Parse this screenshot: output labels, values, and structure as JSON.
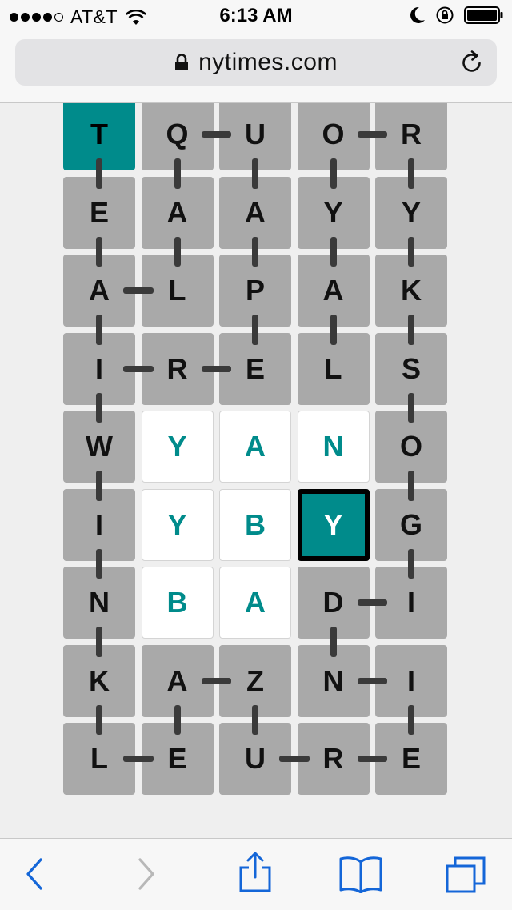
{
  "status_bar": {
    "carrier": "AT&T",
    "signal_bars_filled": 4,
    "signal_bars_total": 5,
    "time": "6:13 AM",
    "icons": [
      "wifi-icon",
      "moon-icon",
      "rotation-lock-icon",
      "battery-icon"
    ]
  },
  "browser": {
    "url": "nytimes.com",
    "icons": [
      "padlock-icon",
      "reload-icon"
    ]
  },
  "board": {
    "rows": [
      [
        "T",
        "Q",
        "U",
        "O",
        "R"
      ],
      [
        "E",
        "A",
        "A",
        "Y",
        "Y"
      ],
      [
        "A",
        "L",
        "P",
        "A",
        "K"
      ],
      [
        "I",
        "R",
        "E",
        "L",
        "S"
      ],
      [
        "W",
        "Y",
        "A",
        "N",
        "O"
      ],
      [
        "I",
        "Y",
        "B",
        "Y",
        "G"
      ],
      [
        "N",
        "B",
        "A",
        "D",
        "I"
      ],
      [
        "K",
        "A",
        "Z",
        "N",
        "I"
      ],
      [
        "L",
        "E",
        "U",
        "R",
        "E"
      ]
    ],
    "states": [
      [
        "teal",
        "grey",
        "grey",
        "grey",
        "grey"
      ],
      [
        "grey",
        "grey",
        "grey",
        "grey",
        "grey"
      ],
      [
        "grey",
        "grey",
        "grey",
        "grey",
        "grey"
      ],
      [
        "grey",
        "grey",
        "grey",
        "grey",
        "grey"
      ],
      [
        "grey",
        "white",
        "white",
        "white",
        "grey"
      ],
      [
        "grey",
        "white",
        "white",
        "selected",
        "grey"
      ],
      [
        "grey",
        "white",
        "white",
        "grey",
        "grey"
      ],
      [
        "grey",
        "grey",
        "grey",
        "grey",
        "grey"
      ],
      [
        "grey",
        "grey",
        "grey",
        "grey",
        "grey"
      ]
    ],
    "links": [
      [
        0,
        0,
        1,
        0
      ],
      [
        1,
        0,
        2,
        0
      ],
      [
        2,
        0,
        3,
        0
      ],
      [
        3,
        0,
        4,
        0
      ],
      [
        4,
        0,
        5,
        0
      ],
      [
        5,
        0,
        6,
        0
      ],
      [
        6,
        0,
        7,
        0
      ],
      [
        7,
        0,
        8,
        0
      ],
      [
        2,
        0,
        2,
        1
      ],
      [
        3,
        0,
        3,
        1
      ],
      [
        3,
        1,
        3,
        2
      ],
      [
        8,
        0,
        8,
        1
      ],
      [
        0,
        1,
        0,
        2
      ],
      [
        0,
        1,
        1,
        1
      ],
      [
        1,
        1,
        2,
        1
      ],
      [
        7,
        1,
        7,
        2
      ],
      [
        7,
        1,
        8,
        1
      ],
      [
        0,
        2,
        1,
        2
      ],
      [
        1,
        2,
        2,
        2
      ],
      [
        2,
        2,
        3,
        2
      ],
      [
        7,
        2,
        8,
        2
      ],
      [
        8,
        2,
        8,
        3
      ],
      [
        0,
        3,
        0,
        4
      ],
      [
        0,
        3,
        1,
        3
      ],
      [
        1,
        3,
        2,
        3
      ],
      [
        2,
        3,
        3,
        3
      ],
      [
        6,
        3,
        6,
        4
      ],
      [
        6,
        3,
        7,
        3
      ],
      [
        7,
        3,
        7,
        4
      ],
      [
        8,
        3,
        8,
        4
      ],
      [
        0,
        4,
        1,
        4
      ],
      [
        1,
        4,
        2,
        4
      ],
      [
        2,
        4,
        3,
        4
      ],
      [
        3,
        4,
        4,
        4
      ],
      [
        4,
        4,
        5,
        4
      ],
      [
        5,
        4,
        6,
        4
      ],
      [
        7,
        4,
        8,
        4
      ]
    ],
    "colors": {
      "grey": "#a9a9a9",
      "teal": "#008b8b",
      "white": "#ffffff",
      "link": "#3a3a3a"
    }
  },
  "toolbar": {
    "buttons": [
      {
        "name": "back-button",
        "icon": "chevron-left-icon",
        "enabled": true
      },
      {
        "name": "forward-button",
        "icon": "chevron-right-icon",
        "enabled": false
      },
      {
        "name": "share-button",
        "icon": "share-icon",
        "enabled": true
      },
      {
        "name": "bookmarks-button",
        "icon": "book-icon",
        "enabled": true
      },
      {
        "name": "tabs-button",
        "icon": "tabs-icon",
        "enabled": true
      }
    ],
    "accent": "#1466d8",
    "disabled": "#b8b8b8"
  }
}
